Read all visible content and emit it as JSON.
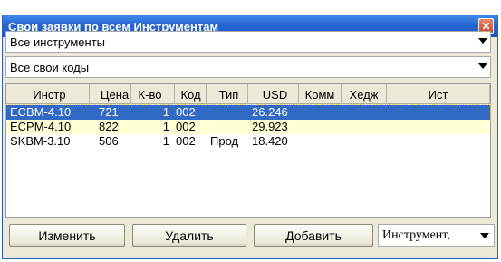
{
  "window": {
    "title": "Свои заявки по всем Инструментам",
    "close_label": "✕"
  },
  "filters": {
    "instrument_select": "Все инструменты",
    "codes_select": "Все свои коды"
  },
  "table": {
    "columns": [
      "Инстр",
      "Цена",
      "К-во",
      "Код",
      "Тип",
      "USD",
      "Комм",
      "Хедж",
      "Ист"
    ],
    "rows": [
      {
        "instr": "ECBM-4.10",
        "price": "721",
        "qty": "1",
        "code": "002",
        "type": "",
        "usd": "26.246",
        "comm": "",
        "hedge": "",
        "src": "",
        "state": "selected"
      },
      {
        "instr": "ECPM-4.10",
        "price": "822",
        "qty": "1",
        "code": "002",
        "type": "",
        "usd": "29.923",
        "comm": "",
        "hedge": "",
        "src": "",
        "state": "highlight"
      },
      {
        "instr": "SKBM-3.10",
        "price": "506",
        "qty": "1",
        "code": "002",
        "type": "Прод",
        "usd": "18.420",
        "comm": "",
        "hedge": "",
        "src": "",
        "state": "normal"
      }
    ]
  },
  "buttons": {
    "edit": "Изменить",
    "delete": "Удалить",
    "add": "Добавить"
  },
  "bottom_select": "Инструмент,",
  "colors": {
    "titlebar": "#2766d1",
    "selection": "#316ac5",
    "highlight_row": "#ffffd6",
    "window_bg": "#ece9d8"
  }
}
